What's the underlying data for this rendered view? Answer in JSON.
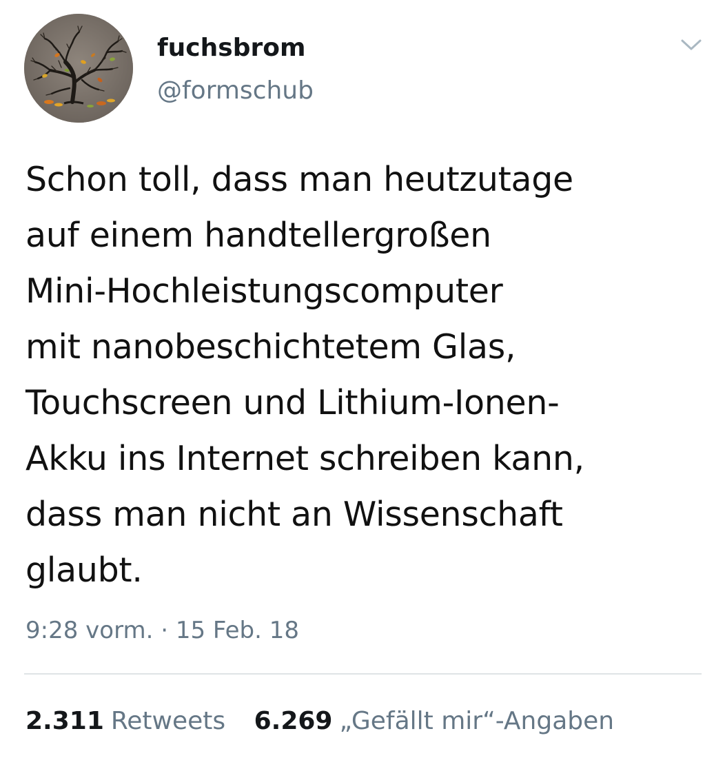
{
  "author": {
    "display_name": "fuchsbrom",
    "handle": "@formschub",
    "avatar_icon": "tree-avatar"
  },
  "menu": {
    "icon": "chevron-down-icon"
  },
  "tweet": {
    "text": "Schon toll, dass man heutzutage\nauf einem handtellergroßen\nMini-Hochleistungscomputer\nmit nanobeschichtetem Glas,\nTouchscreen und Lithium-Ionen-\nAkku ins Internet schreiben kann,\ndass man nicht an Wissenschaft\nglaubt.",
    "timestamp": "9:28 vorm. · 15 Feb. 18"
  },
  "stats": {
    "retweets_count": "2.311",
    "retweets_label": "Retweets",
    "likes_count": "6.269",
    "likes_label": "„Gefällt mir“-Angaben"
  },
  "colors": {
    "primary_text": "#14171a",
    "secondary_text": "#657786",
    "divider": "#dfe3e6",
    "background": "#ffffff"
  }
}
